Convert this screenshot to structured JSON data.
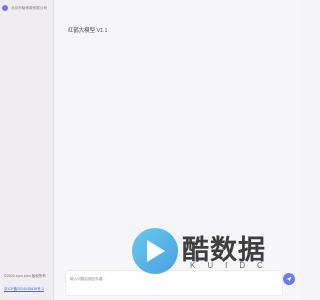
{
  "sidebar": {
    "brand_name": "北京市勉桦政有限公司",
    "copyright": "©2024 xyxx.com 版权所有",
    "icp": "京ICP备2024045678号-1"
  },
  "main": {
    "title": "红鹤大模型 V1.1",
    "input_placeholder": "输入问题后按回车键..."
  },
  "icons": {
    "send": "send-icon",
    "brand_logo": "brand-logo-icon"
  },
  "colors": {
    "accent": "#6c7cf2",
    "link": "#4a6bd8",
    "sidebar_bg": "#efedf2"
  },
  "watermark": {
    "name": "酷数据",
    "sub": "KUIDC"
  }
}
